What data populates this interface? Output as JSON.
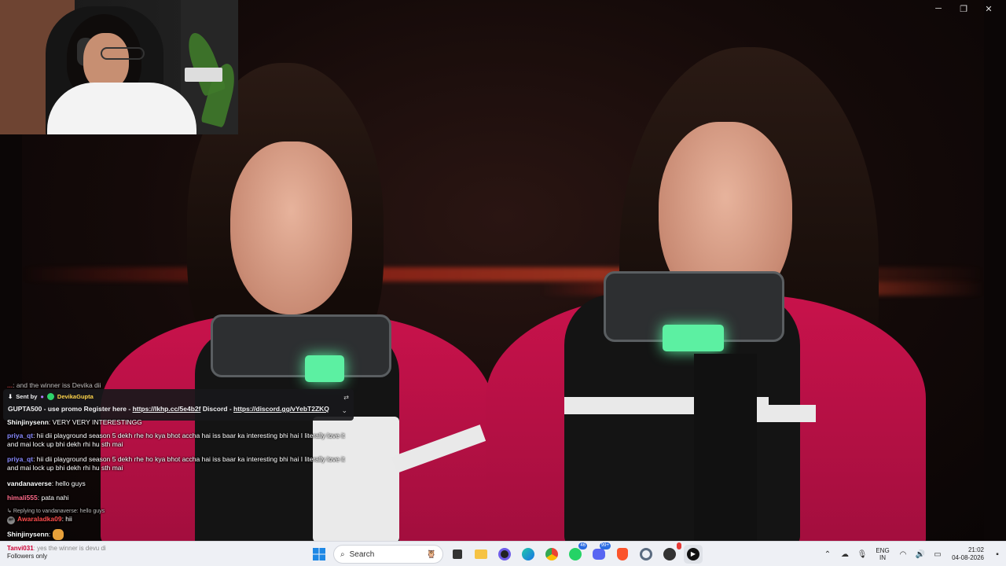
{
  "window": {
    "minimize": "─",
    "restore": "❐",
    "close": "✕"
  },
  "chat": {
    "partial_top": {
      "user": "...",
      "text": ": and the winner iss Devika dii"
    },
    "pinned": {
      "sent_by_label": "Sent by",
      "sender": "DevikaGupta",
      "message_prefix": "GUPTA500 - use promo Register here - ",
      "link1": "https://lkhp.cc/5e4b2f",
      "middle": " Discord - ",
      "link2": "https://discord.gg/vYebT2ZKQ"
    },
    "messages": [
      {
        "user": "Shinjinysenn",
        "color": "#ffffff",
        "text": ": VERY VERY INTERESTINGG"
      },
      {
        "user": "priya_qt",
        "color": "#8a8aff",
        "text": ": hii dii playground season 5 dekh rhe ho kya bhot accha hai iss baar ka interesting bhi hai I literally love it",
        "text2": "and mai lock up bhi dekh rhi hu sth mai"
      },
      {
        "user": "priya_qt",
        "color": "#8a8aff",
        "text": ": hii dii playground season 5 dekh rhe ho kya bhot accha hai iss baar ka interesting bhi hai I literally love it",
        "text2": "and mai lock up bhi dekh rhi hu sth mai"
      },
      {
        "user": "vandanaverse",
        "color": "#ffffff",
        "text": ": hello guys"
      },
      {
        "user": "himali555",
        "color": "#ff6b8a",
        "text": ": pata nahi"
      },
      {
        "reply_label": "Replying to vandanaverse: hello guys"
      },
      {
        "user": "Awaraladka09",
        "color": "#ff4d4d",
        "text": ": hii"
      },
      {
        "user": "Shinjinysenn",
        "color": "#ffffff",
        "text": ":"
      }
    ],
    "bottom_user": "Tanvi031",
    "bottom_text": ": yes the winner is devu di",
    "bottom_status": "Followers only"
  },
  "taskbar": {
    "search_placeholder": "Search",
    "badge_whatsapp": "46",
    "badge_discord": "99+",
    "lang_line1": "ENG",
    "lang_line2": "IN",
    "time": "21:02",
    "date": "04-08-2026"
  },
  "icons": [
    "windows-start-icon",
    "search-icon",
    "task-view-icon",
    "file-explorer-icon",
    "obs-icon",
    "edge-icon",
    "chrome-icon",
    "whatsapp-icon",
    "discord-icon",
    "brave-icon",
    "settings-icon",
    "app-icon",
    "media-player-icon"
  ]
}
